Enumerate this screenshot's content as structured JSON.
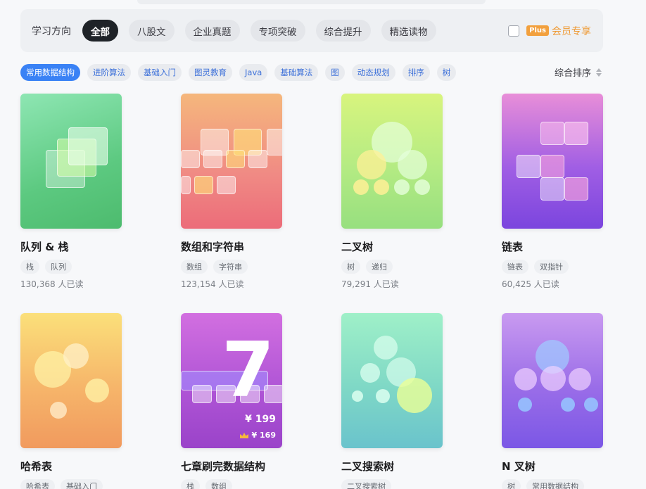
{
  "filters": {
    "direction_label": "学习方向",
    "categories": [
      "全部",
      "八股文",
      "企业真题",
      "专项突破",
      "综合提升",
      "精选读物"
    ],
    "active_index": 0,
    "plus_badge": "Plus",
    "plus_label": "会员专享"
  },
  "tags": {
    "items": [
      "常用数据结构",
      "进阶算法",
      "基础入门",
      "图灵教育",
      "Java",
      "基础算法",
      "图",
      "动态规划",
      "排序",
      "树"
    ],
    "active_index": 0,
    "sort_label": "综合排序"
  },
  "books": [
    {
      "title": "队列 & 栈",
      "tags": [
        "栈",
        "队列"
      ],
      "reads": "130,368 人已读",
      "cover_style": "green-squares"
    },
    {
      "title": "数组和字符串",
      "tags": [
        "数组",
        "字符串"
      ],
      "reads": "123,154 人已读",
      "cover_style": "orange-red-grid"
    },
    {
      "title": "二叉树",
      "tags": [
        "树",
        "递归"
      ],
      "reads": "79,291 人已读",
      "cover_style": "lime-tree"
    },
    {
      "title": "链表",
      "tags": [
        "链表",
        "双指针"
      ],
      "reads": "60,425 人已读",
      "cover_style": "purple-linked"
    },
    {
      "title": "哈希表",
      "tags": [
        "哈希表",
        "基础入门"
      ],
      "reads": "",
      "cover_style": "yellow-orange-bubbles"
    },
    {
      "title": "七章刷完数据结构",
      "tags": [
        "栈",
        "数组"
      ],
      "reads": "",
      "cover_style": "purple-seven",
      "price": "¥ 199",
      "member_price": "¥ 169"
    },
    {
      "title": "二叉搜索树",
      "tags": [
        "二叉搜索树"
      ],
      "reads": "",
      "cover_style": "mint-tree"
    },
    {
      "title": "N 叉树",
      "tags": [
        "树",
        "常用数据结构"
      ],
      "reads": "",
      "cover_style": "violet-ntree"
    }
  ],
  "colors": {
    "accent_blue": "#3a82f5",
    "plus_orange": "#ef9a34",
    "active_pill": "#1f2328"
  }
}
